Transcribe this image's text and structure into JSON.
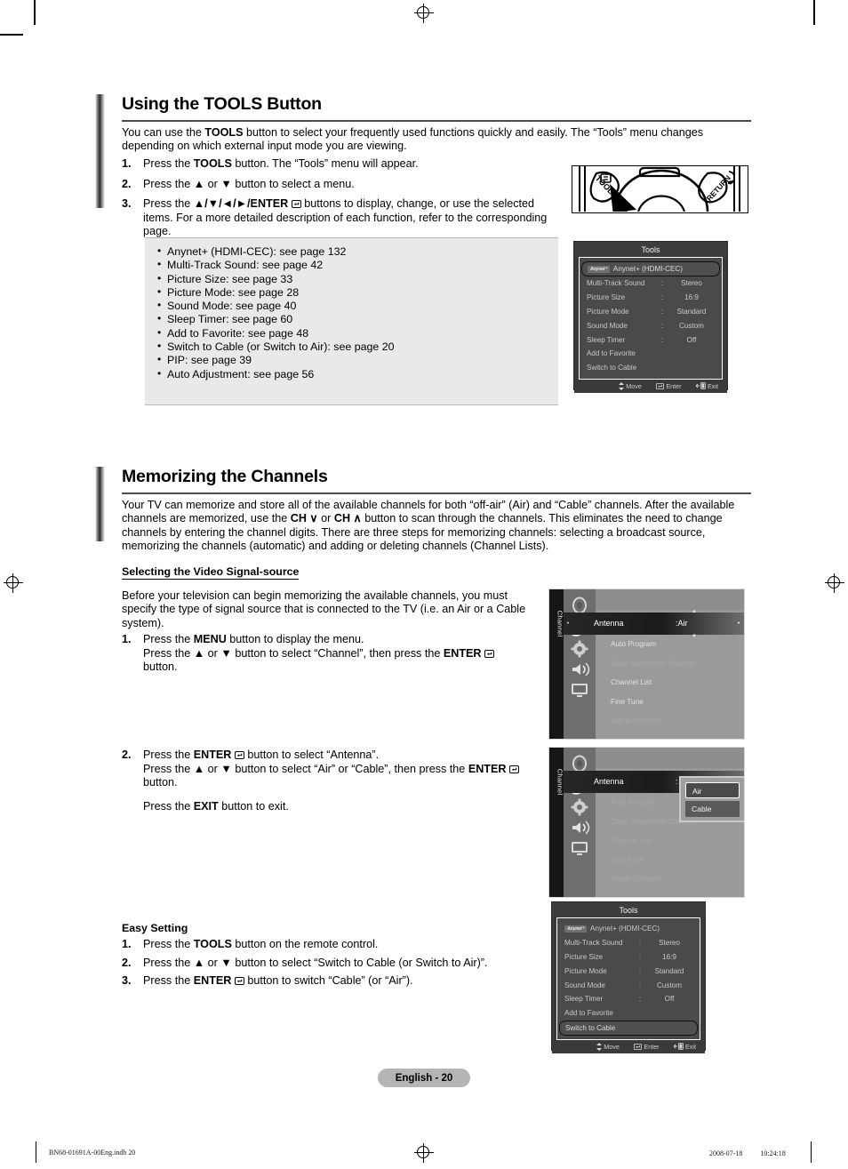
{
  "sections": [
    {
      "title": "Using the TOOLS Button",
      "intro": "You can use the TOOLS button to select your frequently used functions quickly and easily. The “Tools” menu changes depending on which external input mode you are viewing.",
      "steps": [
        {
          "num": "1.",
          "text": "Press the TOOLS button. The “Tools” menu will appear."
        },
        {
          "num": "2.",
          "text": "Press the ▲ or ▼ button to select a menu."
        },
        {
          "num": "3.",
          "text": "Press the ▲/▼/◄/►/ENTER ↵ buttons to display, change, or use the selected items. For a more detailed description of each function, refer to the corresponding page."
        }
      ]
    },
    {
      "title": "Memorizing the Channels",
      "intro": "Your TV can memorize and store all of the available channels for both “off-air” (Air) and “Cable” channels. After the available channels are memorized, use the CH ∨ or CH ∧ button to scan through the channels. This eliminates the need to change channels by entering the channel digits. There are three steps for memorizing channels: selecting a broadcast source, memorizing the channels (automatic) and adding or deleting channels (Channel Lists)."
    }
  ],
  "bullet_box": {
    "items": [
      "Anynet+ (HDMI-CEC): see page 132",
      "Multi-Track Sound: see page 42",
      "Picture Size: see page 33",
      "Picture Mode: see page 28",
      "Sound Mode: see page 40",
      "Sleep Timer: see page 60",
      "Add to Favorite: see page 48",
      "Switch to Cable (or Switch to Air): see page 20",
      "PIP: see page 39",
      "Auto Adjustment: see page 56"
    ]
  },
  "signal_source": {
    "heading": "Selecting the Video Signal-source",
    "intro": "Before your television can begin memorizing the available channels, you must specify the type of signal source that is connected to the TV (i.e. an Air or a Cable system).",
    "steps": [
      {
        "num": "1.",
        "lines": [
          "Press the MENU button to display the menu.",
          "Press the ▲ or ▼ button to select “Channel”, then press the ENTER ↵ button."
        ]
      },
      {
        "num": "2.",
        "lines": [
          "Press the ENTER ↵ button to select “Antenna”.",
          "Press the ▲ or ▼ button to select “Air” or “Cable”, then press the ENTER ↵ button.",
          "Press the EXIT button to exit."
        ]
      }
    ]
  },
  "easy_setting": {
    "heading": "Easy Setting",
    "steps": [
      {
        "num": "1.",
        "text": "Press the TOOLS button on the remote control."
      },
      {
        "num": "2.",
        "text": "Press the ▲ or ▼ button to select “Switch to Cable (or Switch to Air)”."
      },
      {
        "num": "3.",
        "text": "Press the ENTER ↵ button to switch “Cable” (or “Air”)."
      }
    ]
  },
  "tools_menu_top": {
    "title": "Tools",
    "badge": "Anynet⁺",
    "rows": [
      {
        "label": "Anynet+ (HDMI-CEC)",
        "colon": "",
        "value": "",
        "selected": true,
        "badge": true
      },
      {
        "label": "Multi-Track Sound",
        "colon": ":",
        "value": "Stereo",
        "selected": false
      },
      {
        "label": "Picture Size",
        "colon": ":",
        "value": "16:9",
        "selected": false
      },
      {
        "label": "Picture Mode",
        "colon": ":",
        "value": "Standard",
        "selected": false
      },
      {
        "label": "Sound Mode",
        "colon": ":",
        "value": "Custom",
        "selected": false
      },
      {
        "label": "Sleep Timer",
        "colon": ":",
        "value": "Off",
        "selected": false
      },
      {
        "label": "Add to Favorite",
        "colon": "",
        "value": "",
        "selected": false
      },
      {
        "label": "Switch to Cable",
        "colon": "",
        "value": "",
        "selected": false
      }
    ],
    "footer": {
      "move": "Move",
      "enter": "Enter",
      "exit": "Exit"
    }
  },
  "tools_menu_bottom": {
    "title": "Tools",
    "badge": "Anynet⁺",
    "rows": [
      {
        "label": "Anynet+ (HDMI-CEC)",
        "colon": "",
        "value": "",
        "selected": false,
        "badge": true
      },
      {
        "label": "Multi-Track Sound",
        "colon": ":",
        "value": "Stereo",
        "selected": false
      },
      {
        "label": "Picture Size",
        "colon": ":",
        "value": "16:9",
        "selected": false
      },
      {
        "label": "Picture Mode",
        "colon": ":",
        "value": "Standard",
        "selected": false
      },
      {
        "label": "Sound Mode",
        "colon": ":",
        "value": "Custom",
        "selected": false
      },
      {
        "label": "Sleep Timer",
        "colon": ":",
        "value": "Off",
        "selected": false
      },
      {
        "label": "Add to Favorite",
        "colon": "",
        "value": "",
        "selected": false
      },
      {
        "label": "Switch to Cable",
        "colon": "",
        "value": "",
        "selected": true
      }
    ],
    "footer": {
      "move": "Move",
      "enter": "Enter",
      "exit": "Exit"
    }
  },
  "channel_menu_1": {
    "tab_label": "Channel",
    "selected_row": {
      "name": "Antenna",
      "value": ":Air"
    },
    "rows": [
      {
        "label": "Auto Program",
        "disabled": false
      },
      {
        "label": "Clear Scrambled Channel",
        "disabled": true
      },
      {
        "label": "Channel List",
        "disabled": false
      },
      {
        "label": "Fine Tune",
        "disabled": false
      },
      {
        "label": "Signal Strength",
        "disabled": true
      }
    ]
  },
  "channel_menu_2": {
    "tab_label": "Channel",
    "selected_row": {
      "name": "Antenna",
      "value": ":"
    },
    "rows": [
      {
        "label": "Auto Program",
        "disabled": true
      },
      {
        "label": "Clear Scrambled Channel",
        "disabled": true
      },
      {
        "label": "Channel List",
        "disabled": true
      },
      {
        "label": "Fine Tune",
        "disabled": true
      },
      {
        "label": "Signal Strength",
        "disabled": true
      }
    ],
    "dropdown": {
      "options": [
        "Air",
        "Cable"
      ],
      "selected": "Air"
    }
  },
  "footer": {
    "page_label": "English - 20",
    "print_left": "BN68-01691A-00Eng.indb   20",
    "print_right": "2008-07-18   　　 10:24:18"
  }
}
